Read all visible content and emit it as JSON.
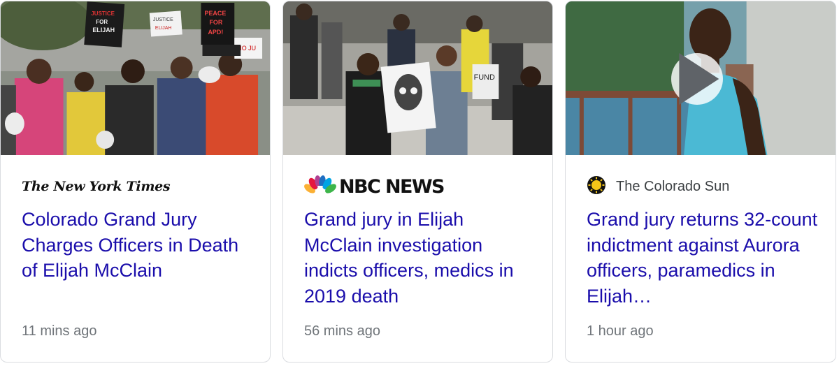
{
  "articles": [
    {
      "source": "The New York Times",
      "headline": "Colorado Grand Jury Charges Officers in Death of Elijah McClain",
      "time": "11 mins ago",
      "image_signs": [
        "JUSTICE FOR ELIJAH",
        "JUSTICE FOR ELIJAH",
        "PEACE FOR APD!",
        "NO JU"
      ]
    },
    {
      "source": "NBC NEWS",
      "headline": "Grand jury in Elijah McClain investigation indicts officers, medics in 2019 death",
      "time": "56 mins ago",
      "image_signs": [
        "FUND"
      ]
    },
    {
      "source": "The Colorado Sun",
      "headline": "Grand jury returns 32-count indictment against Aurora officers, paramedics in Elijah…",
      "time": "1 hour ago",
      "has_video": true
    }
  ],
  "colors": {
    "headline": "#1a0dab",
    "time": "#70757a",
    "source": "#3c4043",
    "border": "#dadce0",
    "sun_yellow": "#f5c518"
  },
  "icons": [
    "nbc-peacock-icon",
    "colorado-sun-icon",
    "play-icon"
  ]
}
